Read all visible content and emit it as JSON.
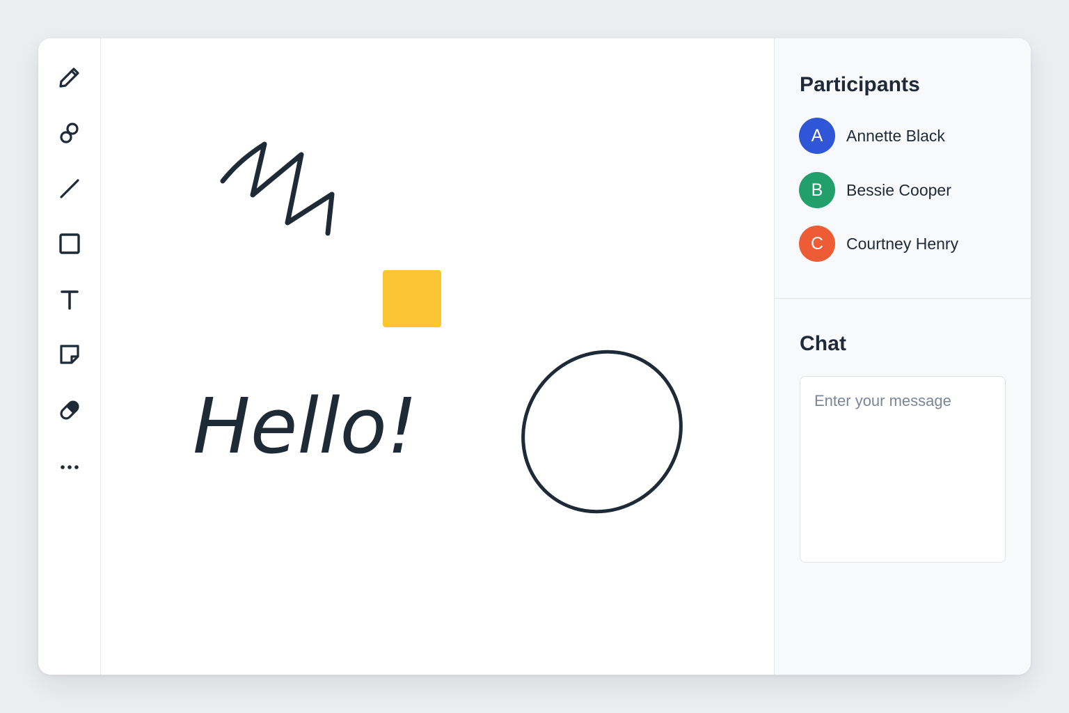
{
  "toolbar": {
    "tools": [
      {
        "name": "pencil-icon"
      },
      {
        "name": "shapes-icon"
      },
      {
        "name": "line-icon"
      },
      {
        "name": "rectangle-icon"
      },
      {
        "name": "text-icon",
        "glyph": "T"
      },
      {
        "name": "sticky-note-icon"
      },
      {
        "name": "eraser-icon"
      },
      {
        "name": "more-icon"
      }
    ]
  },
  "canvas": {
    "text_note": "Hello!",
    "colors": {
      "ink": "#1f2a37",
      "sticky": "#fcc533"
    }
  },
  "participants": {
    "title": "Participants",
    "list": [
      {
        "initial": "A",
        "name": "Annette Black",
        "color": "#2f56d6"
      },
      {
        "initial": "B",
        "name": "Bessie Cooper",
        "color": "#22a06b"
      },
      {
        "initial": "C",
        "name": "Courtney Henry",
        "color": "#ee5c35"
      }
    ]
  },
  "chat": {
    "title": "Chat",
    "placeholder": "Enter your message"
  }
}
